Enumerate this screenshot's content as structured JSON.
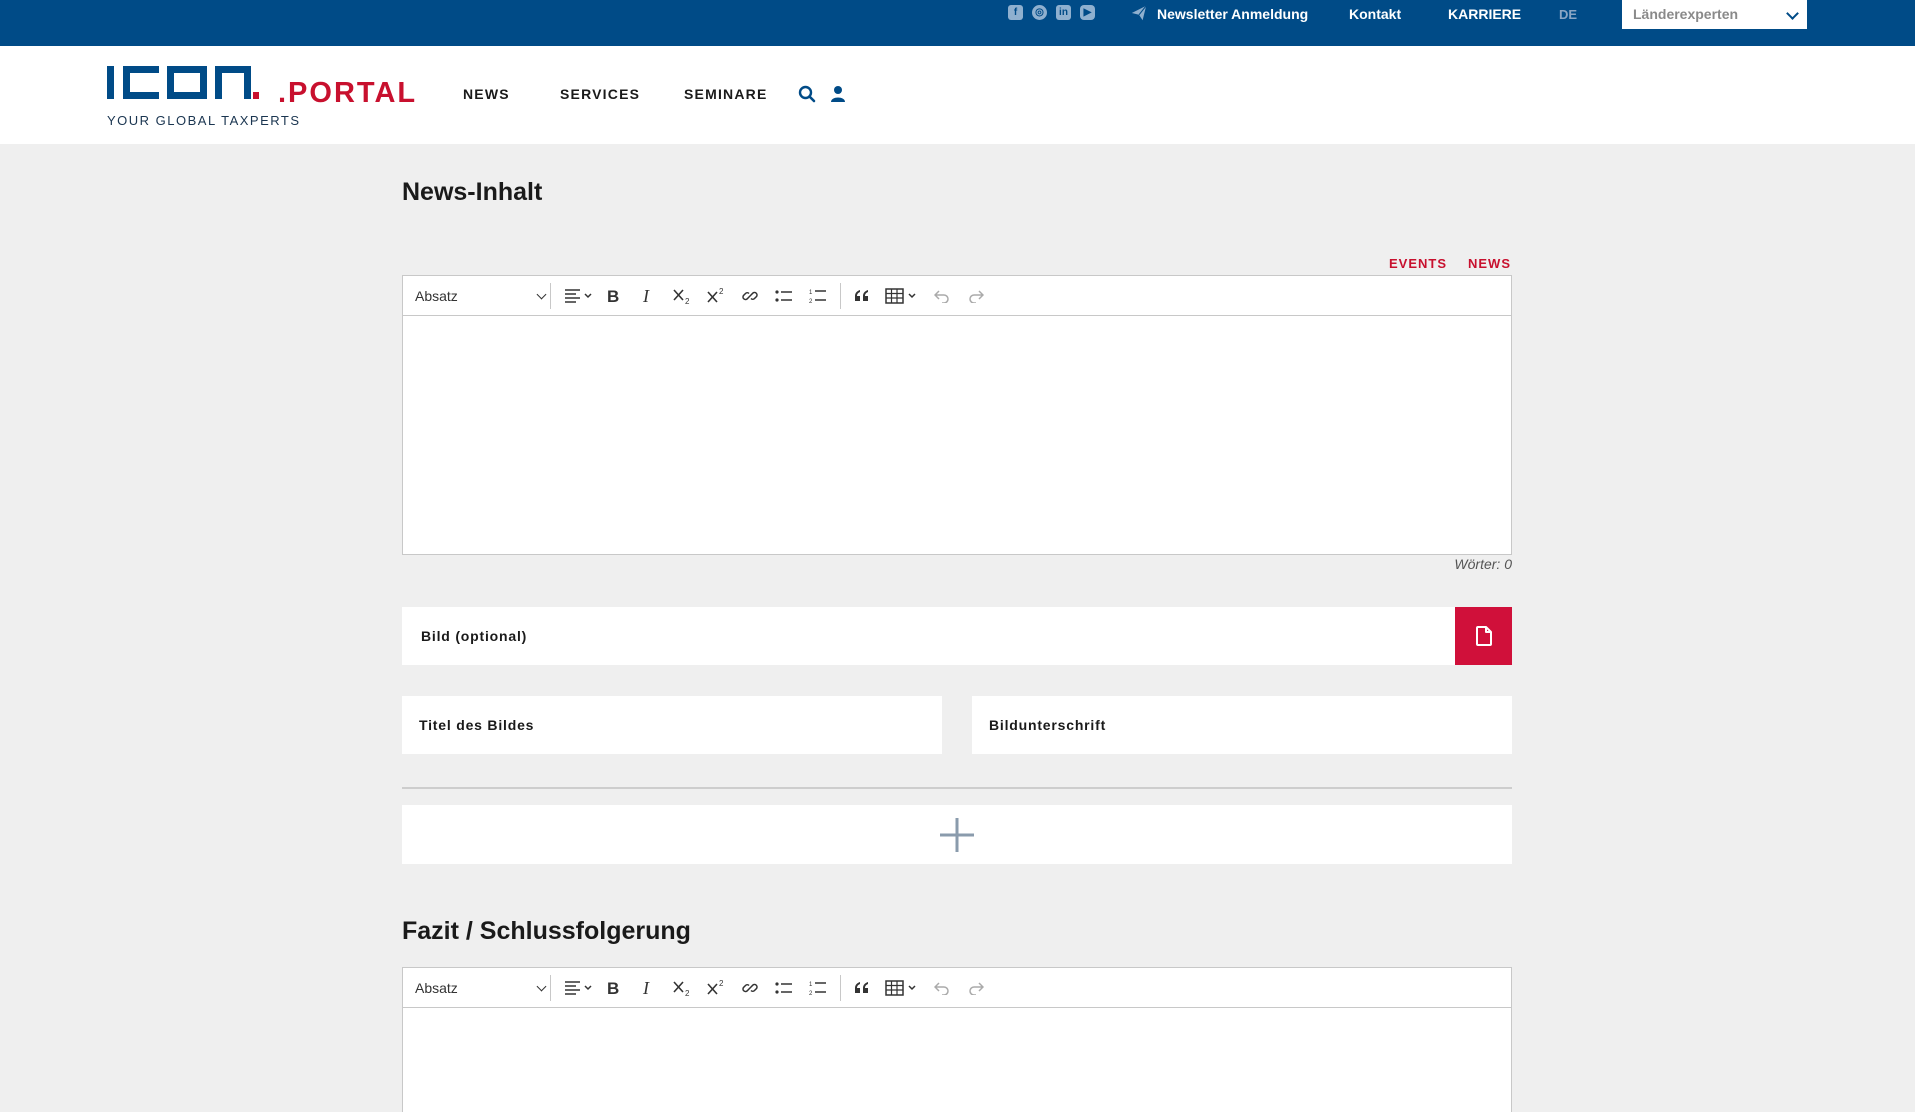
{
  "topbar": {
    "social_icons": [
      "facebook-icon",
      "instagram-icon",
      "linkedin-icon",
      "youtube-icon"
    ],
    "newsletter": "Newsletter Anmeldung",
    "kontakt": "Kontakt",
    "karriere": "KARRIERE",
    "language": "DE",
    "experts_select": "Länderexperten"
  },
  "header": {
    "logo_mark": "ICON",
    "logo_portal": ".PORTAL",
    "logo_tagline": "YOUR GLOBAL TAXPERTS",
    "nav": [
      "NEWS",
      "SERVICES",
      "SEMINARE"
    ]
  },
  "news_section": {
    "title": "News-Inhalt",
    "tags": [
      "EVENTS",
      "NEWS"
    ],
    "editor": {
      "paragraph_select": "Absatz",
      "content": "",
      "word_count": "Wörter: 0"
    },
    "image_field": "Bild (optional)",
    "image_title_field": "Titel des Bildes",
    "image_caption_field": "Bildunterschrift"
  },
  "conclusion_section": {
    "title": "Fazit / Schlussfolgerung",
    "editor": {
      "paragraph_select": "Absatz",
      "content": ""
    }
  },
  "colors": {
    "brand_blue": "#004b87",
    "brand_red": "#c8102e",
    "background": "#efefef"
  }
}
